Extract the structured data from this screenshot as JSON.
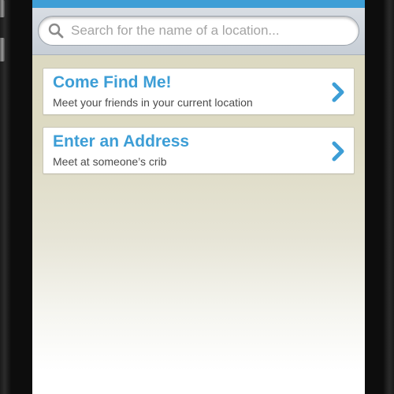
{
  "search": {
    "placeholder": "Search for the name of a location..."
  },
  "options": [
    {
      "title": "Come Find Me!",
      "subtitle": "Meet your friends in your current location",
      "icon": "chevron-right-icon"
    },
    {
      "title": "Enter an Address",
      "subtitle": "Meet at someone’s crib",
      "icon": "chevron-right-icon"
    }
  ],
  "colors": {
    "accent": "#3d9ed6",
    "background_top": "#dcd8c0",
    "background_bottom": "#ffffff",
    "device_frame": "#0d0d0d"
  }
}
